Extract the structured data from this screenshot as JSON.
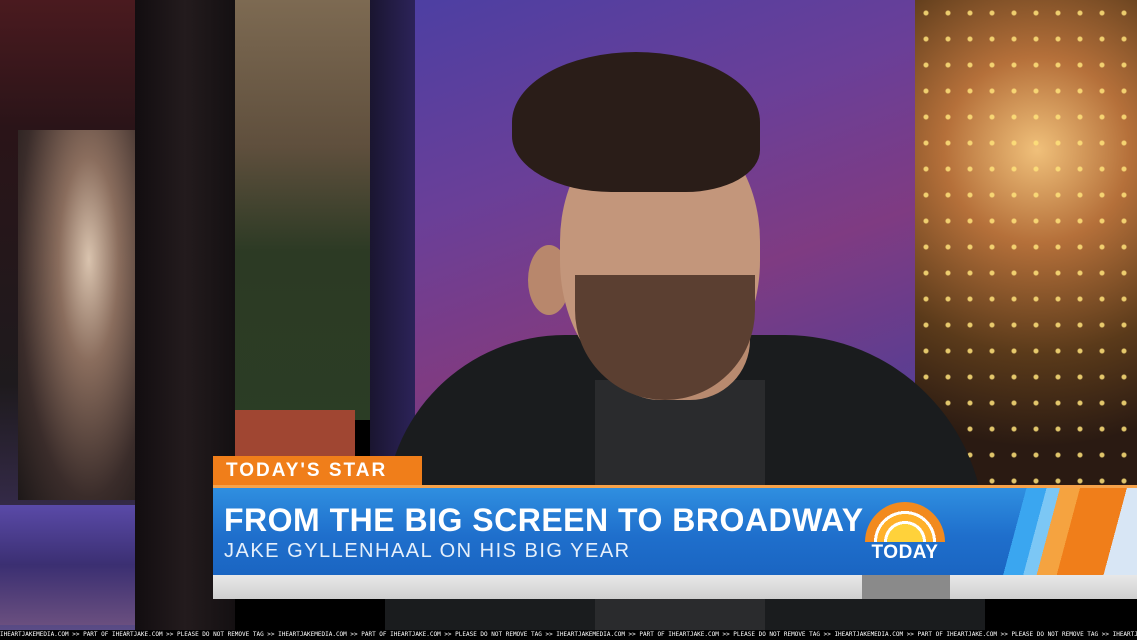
{
  "lower_third": {
    "tag": "TODAY'S STAR",
    "headline": "FROM THE BIG SCREEN TO BROADWAY",
    "subheadline": "JAKE GYLLENHAAL ON HIS BIG YEAR",
    "logo_text": "TODAY"
  },
  "watermark": "IHEARTJAKEMEDIA.COM >> PART OF IHEARTJAKE.COM >> PLEASE DO NOT REMOVE TAG >> IHEARTJAKEMEDIA.COM >> PART OF IHEARTJAKE.COM >> PLEASE DO NOT REMOVE TAG >> IHEARTJAKEMEDIA.COM >> PART OF IHEARTJAKE.COM >> PLEASE DO NOT REMOVE TAG >> IHEARTJAKEMEDIA.COM >> PART OF IHEARTJAKE.COM >> PLEASE DO NOT REMOVE TAG >> IHEARTJAKEMEDIA.COM >> PART OF IHEARTJAKE.COM >> PLEASE DO NOT REMOVE TAG >> IHEARTJAKEMEDIA.COM",
  "colors": {
    "tag_orange": "#f07e1a",
    "banner_blue": "#1f6fcc"
  }
}
